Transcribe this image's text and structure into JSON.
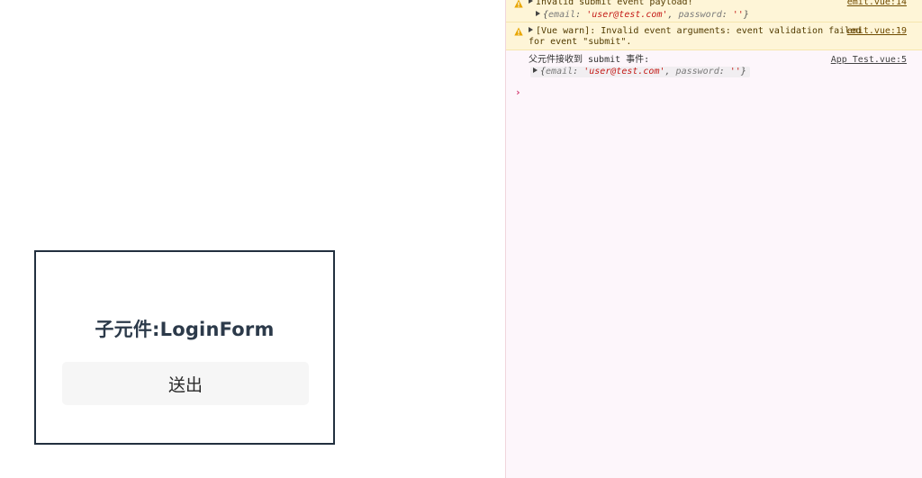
{
  "preview": {
    "card_title": "子元件:LoginForm",
    "submit_label": "送出"
  },
  "console": {
    "messages": [
      {
        "level": "warn",
        "text": "Invalid submit event payload!",
        "source": "emit.vue:14",
        "object": {
          "email_key": "email",
          "email_value": "'user@test.com'",
          "password_key": "password",
          "password_value": "''"
        }
      },
      {
        "level": "warn",
        "text": "[Vue warn]: Invalid event arguments: event validation failed",
        "text2": "for event \"submit\".",
        "source": "emit.vue:19"
      },
      {
        "level": "log",
        "text": "父元件接收到 submit 事件:",
        "source": "App Test.vue:5",
        "object": {
          "email_key": "email",
          "email_value": "'user@test.com'",
          "password_key": "password",
          "password_value": "''"
        }
      }
    ],
    "prompt": "›"
  },
  "colors": {
    "card_border": "#22303f",
    "warn_bg": "#fef5d7",
    "console_bg": "#fdf6fb",
    "string_value": "#c41a16",
    "prompt": "#d2336b"
  }
}
